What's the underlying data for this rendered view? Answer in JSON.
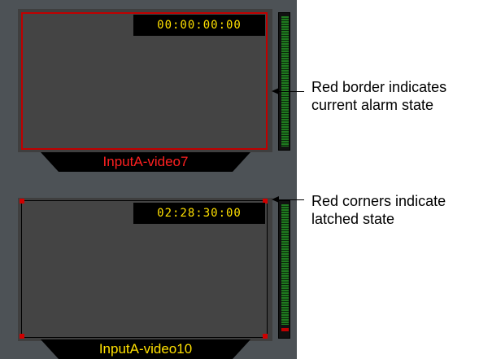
{
  "tiles": [
    {
      "timecode": "00:00:00:00",
      "label": "InputA-video7",
      "label_color": "#ff2020",
      "state": "alarm"
    },
    {
      "timecode": "02:28:30:00",
      "label": "InputA-video10",
      "label_color": "#ffe000",
      "state": "latched"
    }
  ],
  "callouts": [
    {
      "line1": "Red border indicates",
      "line2": "current alarm state"
    },
    {
      "line1": "Red corners indicate",
      "line2": "latched state"
    }
  ],
  "colors": {
    "alarm": "#c00000",
    "timecode": "#ffe000",
    "meter": "#1f7a1f"
  }
}
